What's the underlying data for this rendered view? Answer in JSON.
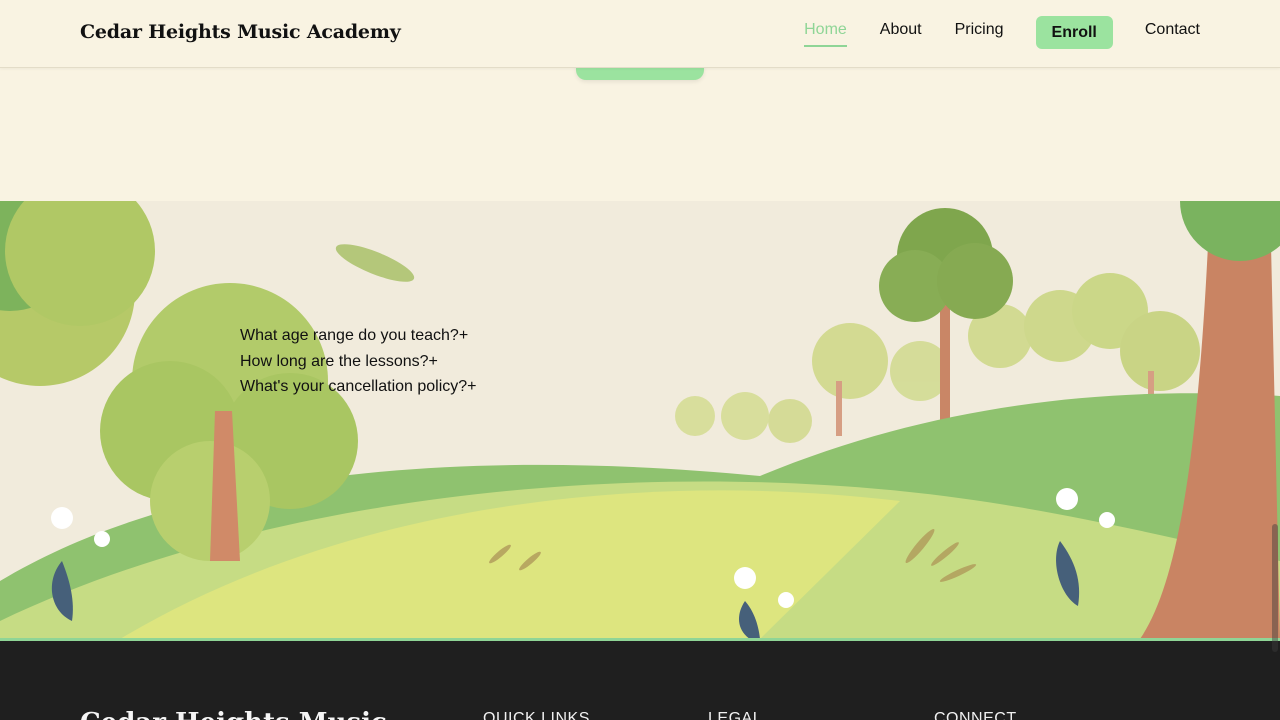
{
  "header": {
    "brand": "Cedar Heights Music Academy",
    "nav": [
      {
        "label": "Home",
        "active": true
      },
      {
        "label": "About"
      },
      {
        "label": "Pricing"
      }
    ],
    "enroll_label": "Enroll",
    "contact_label": "Contact"
  },
  "faq": {
    "items": [
      "What age range do you teach?+",
      "How long are the lessons?+",
      "What's your cancellation policy?+"
    ]
  },
  "footer": {
    "brand": "Cedar Heights Music",
    "headings": [
      "QUICK LINKS",
      "LEGAL",
      "CONNECT"
    ]
  },
  "colors": {
    "accent": "#9be39f",
    "background": "#f9f3e2",
    "footer_bg": "#1f1f1f"
  }
}
